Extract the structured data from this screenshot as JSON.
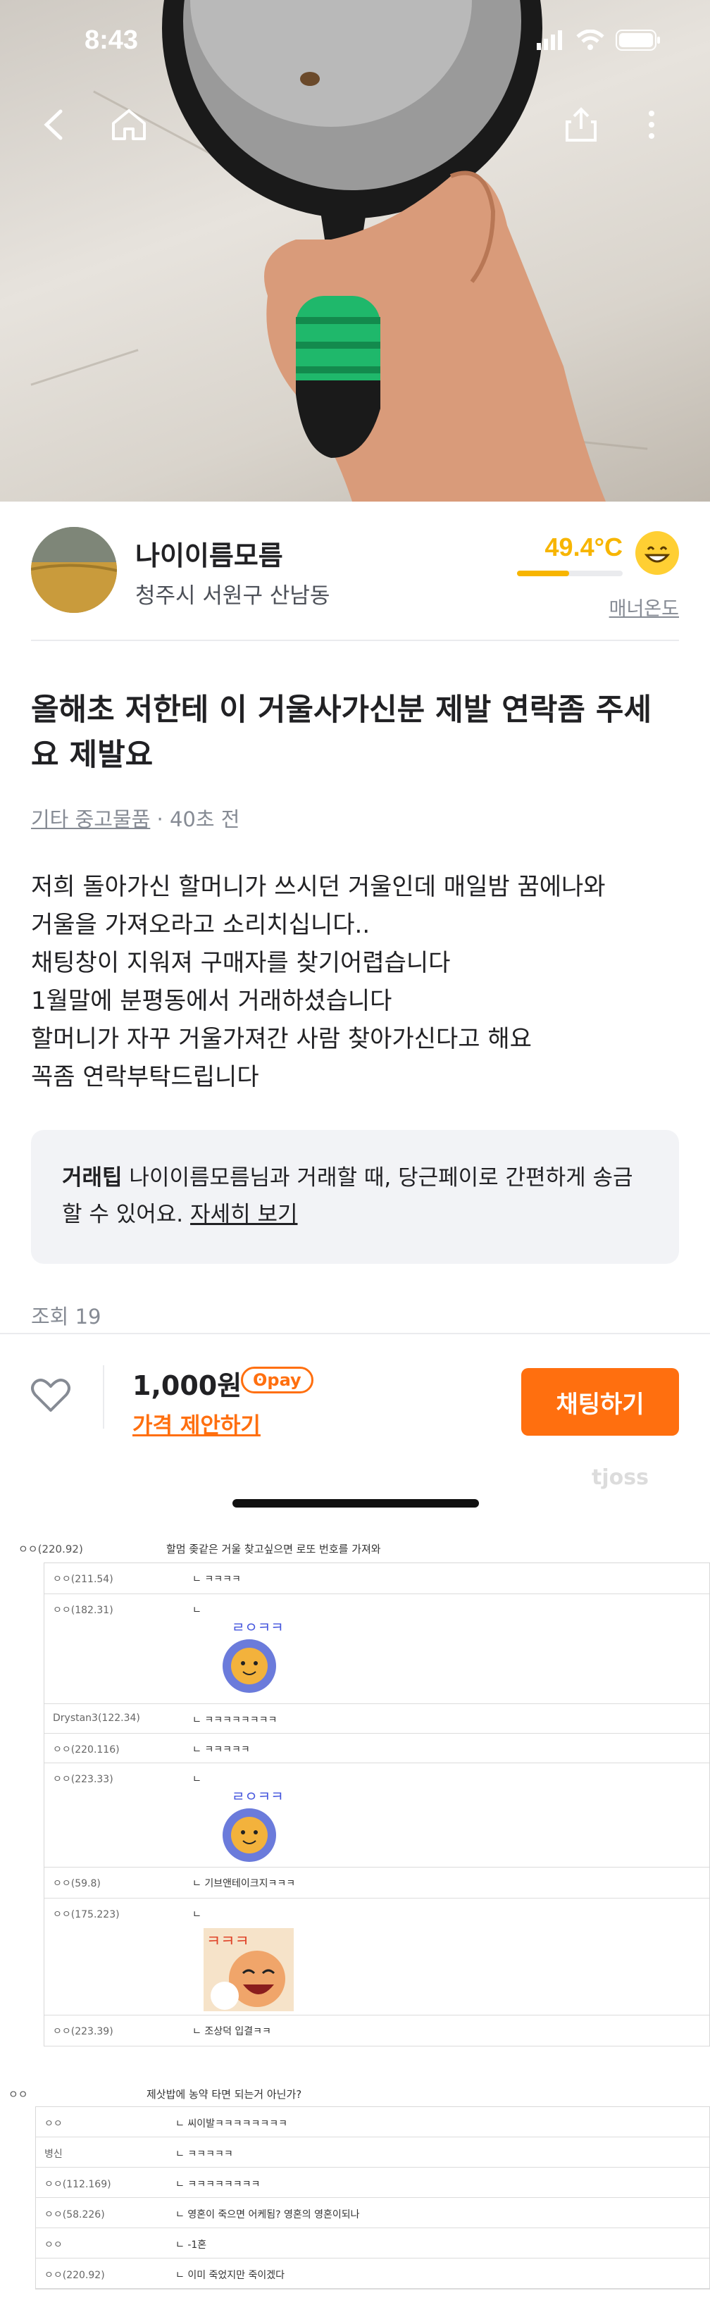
{
  "status_bar": {
    "time": "8:43"
  },
  "seller": {
    "name": "나이이름모름",
    "location": "청주시 서원구 산남동",
    "temperature": "49.4°C",
    "temperature_level": 0.494,
    "manner_label": "매너온도"
  },
  "post": {
    "title": "올해초 저한테 이 거울사가신분 제발 연락좀 주세요 제발요",
    "category": "기타 중고물품",
    "time_ago": "· 40초 전",
    "body_lines": [
      "저희 돌아가신 할머니가 쓰시던 거울인데 매일밤 꿈에나와",
      "거울을 가져오라고 소리치십니다..",
      "채팅창이 지워져 구매자를 찾기어렵습니다",
      "1월말에 분평동에서 거래하셨습니다",
      "할머니가 자꾸 거울가져간 사람 찾아가신다고 해요",
      "꼭좀 연락부탁드립니다"
    ],
    "tip": {
      "label": "거래팁",
      "text": "나이이름모름님과 거래할 때, 당근페이로 간편하게 송금할 수 있어요.",
      "link": "자세히 보기"
    },
    "views": "조회 19"
  },
  "bottom_bar": {
    "price": "1,000원",
    "pay_badge": "pay",
    "offer": "가격 제안하기",
    "chat_button": "채팅하기"
  },
  "watermark": "tjoss",
  "comments_top": {
    "name": "ㅇㅇ(220.92)",
    "text": "할멈 좆같은 거울 찾고싶으면 로또 번호를 가져와"
  },
  "comments": [
    {
      "name": "ㅇㅇ(211.54)",
      "text": "ㄴ ㅋㅋㅋㅋ"
    },
    {
      "name": "ㅇㅇ(182.31)",
      "text": "ㄴ",
      "sticker": "ㄹㅇㅋㅋ"
    },
    {
      "name": "Drystan3(122.34)",
      "text": "ㄴ ㅋㅋㅋㅋㅋㅋㅋㅋ"
    },
    {
      "name": "ㅇㅇ(220.116)",
      "text": "ㄴ ㅋㅋㅋㅋㅋ"
    },
    {
      "name": "ㅇㅇ(223.33)",
      "text": "ㄴ",
      "sticker": "ㄹㅇㅋㅋ"
    },
    {
      "name": "ㅇㅇ(59.8)",
      "text": "ㄴ 기브앤테이크지ㅋㅋㅋ"
    },
    {
      "name": "ㅇㅇ(175.223)",
      "text": "ㄴ",
      "sticker": "ㅋㅋㅋ"
    },
    {
      "name": "ㅇㅇ(223.39)",
      "text": "ㄴ 조상덕 입결ㅋㅋ"
    }
  ],
  "comments2_top": {
    "name": "ㅇㅇ",
    "text": "제삿밥에 농약 타면 되는거 아닌가?"
  },
  "comments2": [
    {
      "name": "ㅇㅇ",
      "text": "ㄴ 씨이발ㅋㅋㅋㅋㅋㅋㅋㅋ"
    },
    {
      "name": "병신",
      "text": "ㄴ ㅋㅋㅋㅋㅋ"
    },
    {
      "name": "ㅇㅇ(112.169)",
      "text": "ㄴ ㅋㅋㅋㅋㅋㅋㅋㅋ"
    },
    {
      "name": "ㅇㅇ(58.226)",
      "text": "ㄴ 영혼이 죽으면 어케됨? 영혼의 영혼이되나"
    },
    {
      "name": "ㅇㅇ",
      "text": "ㄴ -1혼"
    },
    {
      "name": "ㅇㅇ(220.92)",
      "text": "ㄴ 이미 죽었지만 죽이겠다"
    }
  ],
  "colors": {
    "accent": "#ff6f0f",
    "temperature": "#f7b500",
    "muted": "#868b94"
  }
}
